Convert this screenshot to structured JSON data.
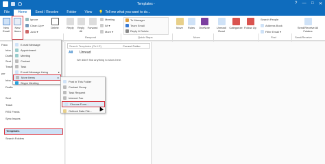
{
  "window": {
    "title": "Templates - ",
    "controls": [
      "?",
      "—",
      "□",
      "✕"
    ]
  },
  "tabs": [
    {
      "label": "File",
      "active": false
    },
    {
      "label": "Home",
      "active": true
    },
    {
      "label": "Send / Receive",
      "active": false
    },
    {
      "label": "Folder",
      "active": false
    },
    {
      "label": "View",
      "active": false
    }
  ],
  "tell_me": {
    "icon": "lightbulb-icon",
    "text": "Tell me what you want to do..."
  },
  "ribbon": {
    "new_email": "New Email",
    "new_items": "New Items",
    "ignore": "Ignore",
    "clean_up": "Clean Up ▾",
    "junk": "Junk ▾",
    "delete": "Delete",
    "reply": "Reply",
    "reply_all": "Reply All",
    "forward": "Forward",
    "meeting": "Meeting",
    "im": "IM ▾",
    "more": "More ▾",
    "quick_steps": [
      {
        "label": "To Manager",
        "icon": "to-manager-icon"
      },
      {
        "label": "Team Email",
        "icon": "team-email-icon"
      },
      {
        "label": "Reply & Delete",
        "icon": "reply-delete-icon"
      }
    ],
    "move": "Move",
    "rules": "Rules",
    "onenote": "OneNote",
    "unread_read": "Unread/ Read",
    "categorize": "Categorize",
    "follow_up": "Follow Up",
    "search_people": "Search People",
    "address_book": "Address Book",
    "filter_email": "Filter Email ▾",
    "send_receive_all": "Send/Receive All Folders",
    "groups": {
      "respond": "Respond",
      "quick_steps": "Quick Steps",
      "move": "Move",
      "find": "Find",
      "send_receive": "Send/Receive"
    }
  },
  "new_items_menu": [
    {
      "label": "E-mail Message",
      "icon": "envelope-icon"
    },
    {
      "label": "Appointment",
      "icon": "calendar-icon"
    },
    {
      "label": "Meeting",
      "icon": "meeting-icon"
    },
    {
      "label": "Contact",
      "icon": "contact-icon"
    },
    {
      "label": "Task",
      "icon": "task-icon"
    },
    {
      "label": "E-mail Message Using",
      "icon": "envelope-icon",
      "submenu": true
    },
    {
      "label": "More Items",
      "icon": "more-items-icon",
      "submenu": true,
      "highlighted": true
    },
    {
      "label": "Skype Meeting",
      "icon": "skype-icon"
    }
  ],
  "more_items_menu": [
    {
      "label": "Post in This Folder",
      "icon": "post-icon"
    },
    {
      "label": "Contact Group",
      "icon": "contact-group-icon"
    },
    {
      "label": "Task Request",
      "icon": "task-request-icon"
    },
    {
      "label": "Internet Fax",
      "icon": "fax-icon"
    },
    {
      "label": "Choose Form...",
      "icon": "form-icon",
      "highlighted": true
    },
    {
      "label": "Outlook Data File...",
      "icon": "data-file-icon"
    }
  ],
  "folders": {
    "favorites_header": "Favo",
    "account_header": "yor",
    "items": [
      "Inbo",
      "Drafts",
      "Sent",
      "Trash",
      "Inbo",
      "Drafts",
      "Sent",
      "Trash",
      "RSS Feeds",
      "Sync Issues",
      "Templates",
      "Search Folders"
    ],
    "selected": "Templates"
  },
  "message_list": {
    "search_placeholder": "Search Templates (Ctrl+E)",
    "scope": "Current Folder",
    "filters": [
      "All",
      "Unread"
    ],
    "empty_text": "We didn't find anything to show here."
  }
}
